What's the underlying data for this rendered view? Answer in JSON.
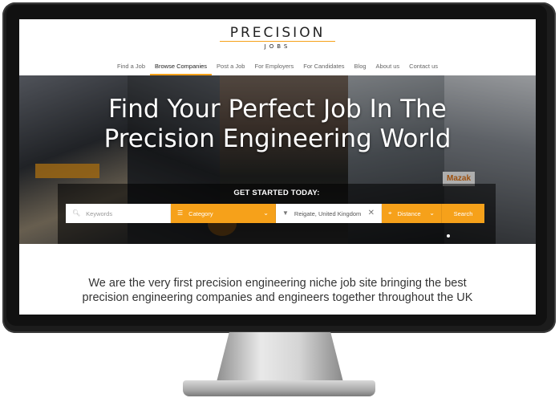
{
  "logo": {
    "word": "PRECISION",
    "sub": "JOBS"
  },
  "nav": {
    "items": [
      {
        "label": "Find a Job"
      },
      {
        "label": "Browse Companies",
        "active": true
      },
      {
        "label": "Post a Job"
      },
      {
        "label": "For Employers"
      },
      {
        "label": "For Candidates"
      },
      {
        "label": "Blog"
      },
      {
        "label": "About us"
      },
      {
        "label": "Contact us"
      }
    ]
  },
  "hero": {
    "title_line1": "Find Your Perfect Job In The",
    "title_line2": "Precision Engineering World",
    "brand_sign": "Mazak"
  },
  "search": {
    "heading": "GET STARTED TODAY:",
    "keywords_placeholder": "Keywords",
    "category_label": "Category",
    "location_value": "Reigate, United Kingdom",
    "distance_label": "Distance",
    "search_button": "Search"
  },
  "tagline": {
    "line1": "We are the very first precision engineering niche job site bringing the best",
    "line2": "precision engineering companies and engineers together throughout the UK"
  },
  "colors": {
    "accent": "#f6a11a",
    "monitor": "#1c1c1c"
  },
  "icons": {
    "search": "search-icon",
    "category": "list-icon",
    "location": "map-pin-icon",
    "distance": "crosshair-icon",
    "clear": "close-icon",
    "chevron": "chevron-down-icon"
  }
}
